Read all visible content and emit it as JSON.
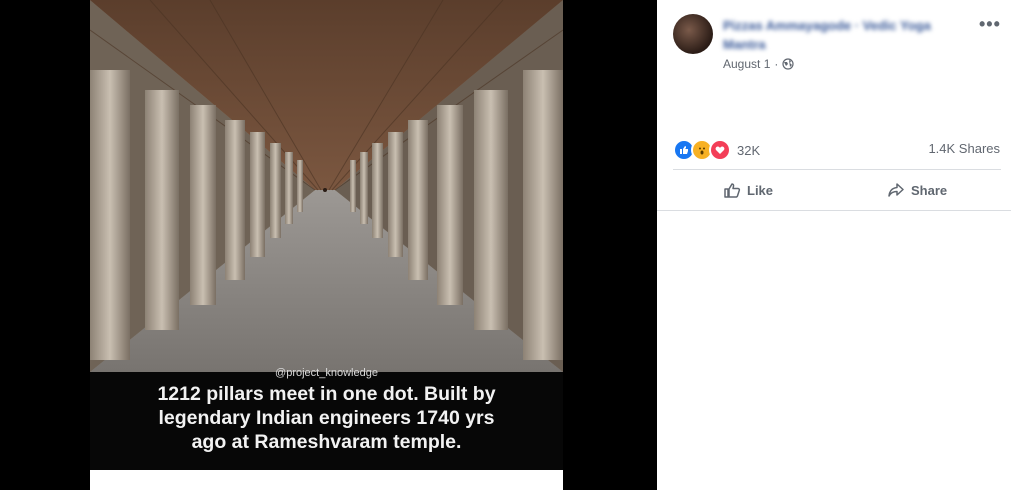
{
  "post": {
    "author": "Pizzas Ammayagode · Vedic Yoga Mantra",
    "date": "August 1",
    "more_label": "•••",
    "reaction_count": "32K",
    "shares": "1.4K Shares",
    "reaction_icons": [
      "like-icon",
      "wow-icon",
      "love-icon"
    ],
    "colors": {
      "like": "#1877f2",
      "wow": "#f7b125",
      "love": "#f33e58",
      "link": "#385898"
    }
  },
  "actions": {
    "like": "Like",
    "share": "Share"
  },
  "image": {
    "watermark": "@project_knowledge",
    "caption_lines": [
      "1212 pillars meet in one dot. Built by",
      "legendary Indian engineers 1740 yrs",
      "ago at Rameshvaram temple."
    ]
  }
}
